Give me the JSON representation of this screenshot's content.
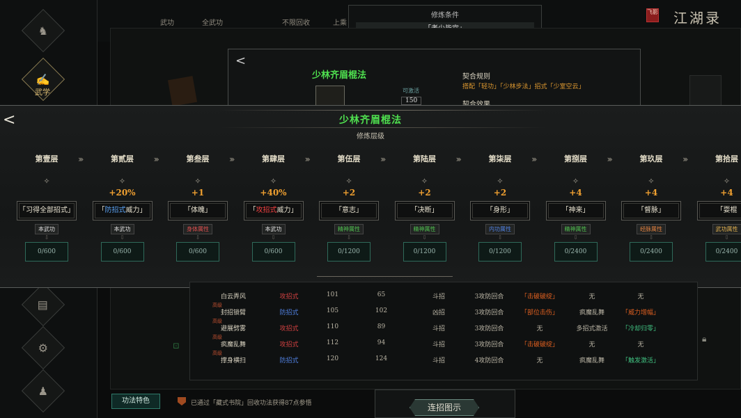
{
  "header": {
    "filter_1": "武功",
    "filter_2": "全武功",
    "filter_3": "不限回收",
    "filter_4": "上乘",
    "cond_title": "修炼条件",
    "cond_value": "「老少皆宜」",
    "brand": "江湖录",
    "seal": "飞影"
  },
  "sidebar": {
    "active_label": "武学"
  },
  "bgmodal": {
    "title": "少林齐眉棍法",
    "match_rule_label": "契合规则",
    "match_rule": "搭配「轻功」「少林步法」招式「少室空云」",
    "match_effect_label": "契合效果",
    "available_label": "可激活",
    "available_value": "150"
  },
  "overlay": {
    "title": "少林齐眉棍法",
    "subtitle": "修炼层级",
    "divider": "—————"
  },
  "layers": [
    {
      "name": "第壹层",
      "bonus": "",
      "skill": "「习得全部招式」",
      "skill_hl": "",
      "tag": "本武功",
      "tag_color": "#dddddd",
      "progress": "0/600"
    },
    {
      "name": "第贰层",
      "bonus": "+20%",
      "skill_pre": "「",
      "skill_hl": "防招式",
      "skill_post": "威力」",
      "hl_color": "#5aa0f0",
      "tag": "本武功",
      "tag_color": "#dddddd",
      "progress": "0/600"
    },
    {
      "name": "第叁层",
      "bonus": "+1",
      "skill": "「体魄」",
      "tag": "身体属性",
      "tag_color": "#e05050",
      "progress": "0/600"
    },
    {
      "name": "第肆层",
      "bonus": "+40%",
      "skill_pre": "「",
      "skill_hl": "攻招式",
      "skill_post": "威力」",
      "hl_color": "#f04040",
      "tag": "本武功",
      "tag_color": "#dddddd",
      "progress": "0/600"
    },
    {
      "name": "第伍层",
      "bonus": "+2",
      "skill": "「意志」",
      "tag": "精神属性",
      "tag_color": "#50c050",
      "progress": "0/1200"
    },
    {
      "name": "第陆层",
      "bonus": "+2",
      "skill": "「决断」",
      "tag": "精神属性",
      "tag_color": "#50c050",
      "progress": "0/1200"
    },
    {
      "name": "第柒层",
      "bonus": "+2",
      "skill": "「身形」",
      "tag": "内功属性",
      "tag_color": "#5080e0",
      "progress": "0/1200"
    },
    {
      "name": "第捌层",
      "bonus": "+4",
      "skill": "「神来」",
      "tag": "精神属性",
      "tag_color": "#50c050",
      "progress": "0/2400"
    },
    {
      "name": "第玖层",
      "bonus": "+4",
      "skill": "「督脉」",
      "tag": "经脉属性",
      "tag_color": "#e08040",
      "progress": "0/2400"
    },
    {
      "name": "第拾层",
      "bonus": "+4",
      "skill": "「耍棍",
      "tag": "武功属性",
      "tag_color": "#e0b050",
      "progress": "0/2400"
    }
  ],
  "table_rows": [
    {
      "name": "白云弄风",
      "type": "攻招式",
      "type_color": "#d04040",
      "c3": "101",
      "c4": "65",
      "c5": "斗招",
      "c6": "3攻防回合",
      "c7": "「击破破绽」",
      "c7_color": "#e06020",
      "c8": "无",
      "c9": "无",
      "c9_color": "#bbb5a5",
      "tag": ""
    },
    {
      "name": "封招锁臂",
      "type": "防招式",
      "type_color": "#5080e0",
      "c3": "105",
      "c4": "102",
      "c5": "凶招",
      "c6": "3攻防回合",
      "c7": "「部位击伤」",
      "c7_color": "#e06020",
      "c8": "疯魔乱舞",
      "c9": "「威力增幅」",
      "c9_color": "#e06020",
      "tag": "高级"
    },
    {
      "name": "避展劈雾",
      "type": "攻招式",
      "type_color": "#d04040",
      "c3": "110",
      "c4": "89",
      "c5": "斗招",
      "c6": "3攻防回合",
      "c7": "无",
      "c7_color": "#bbb5a5",
      "c8": "多招式激活",
      "c9": "「冷却归零」",
      "c9_color": "#40c080",
      "tag": "高级"
    },
    {
      "name": "疯魔乱舞",
      "type": "攻招式",
      "type_color": "#d04040",
      "c3": "112",
      "c4": "94",
      "c5": "斗招",
      "c6": "3攻防回合",
      "c7": "「击破破绽」",
      "c7_color": "#e06020",
      "c8": "无",
      "c9": "无",
      "c9_color": "#bbb5a5",
      "tag": "高级"
    },
    {
      "name": "撑身横扫",
      "type": "防招式",
      "type_color": "#5080e0",
      "c3": "120",
      "c4": "124",
      "c5": "斗招",
      "c6": "4攻防回合",
      "c7": "无",
      "c7_color": "#bbb5a5",
      "c8": "疯魔乱舞",
      "c9": "「触发激活」",
      "c9_color": "#40c080",
      "tag": "高级"
    }
  ],
  "footer": {
    "feature_btn": "功法特色",
    "notice": "已通过「藏式书院」回收功法获得87点参悟",
    "combo_btn": "连招图示"
  }
}
